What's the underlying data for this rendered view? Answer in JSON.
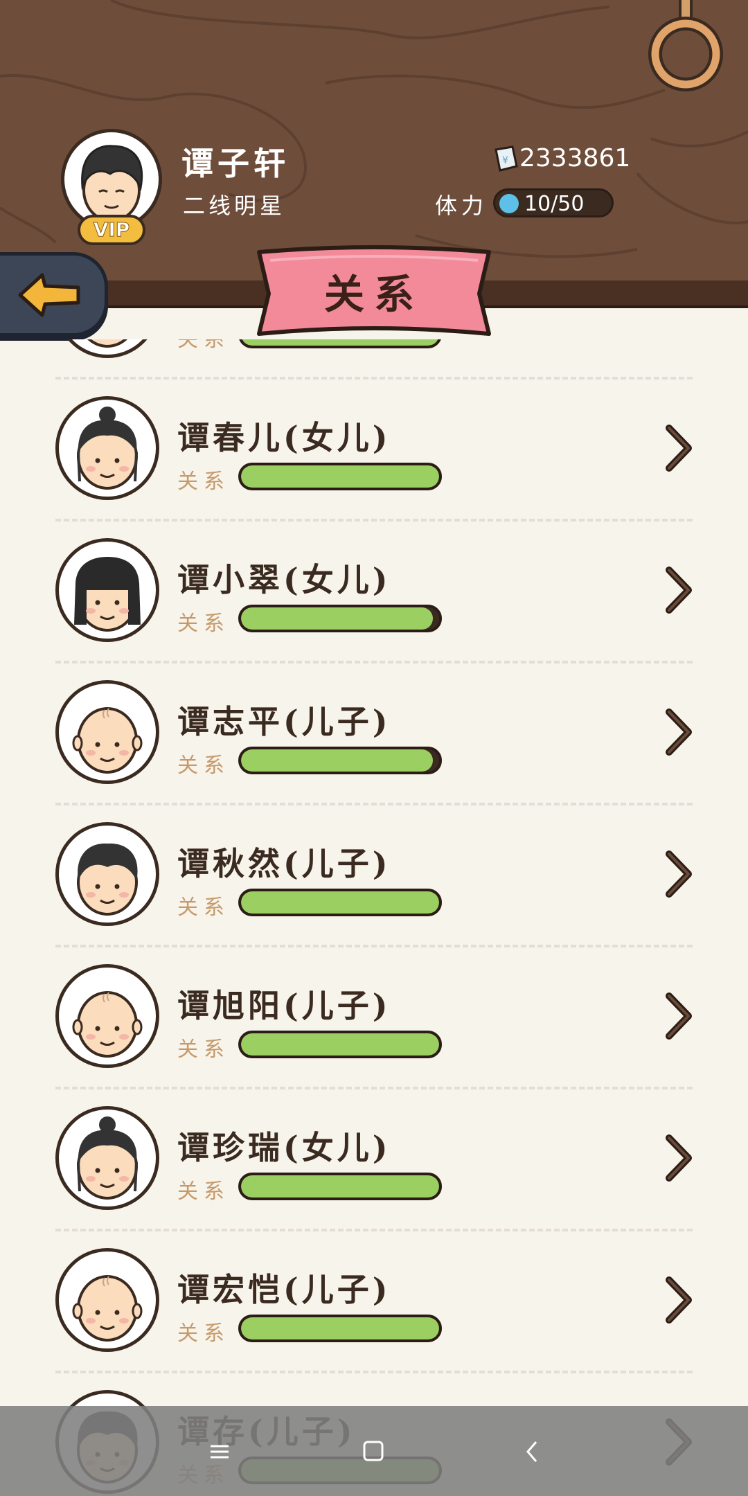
{
  "player": {
    "name": "谭子轩",
    "title": "二线明星",
    "vip": "VIP",
    "money": "2333861",
    "stamina_label": "体力",
    "stamina": "10/50"
  },
  "page": {
    "title": "关系"
  },
  "relation_label": "关系",
  "members": [
    {
      "name": "",
      "relation_level": 1.0,
      "hair": "bald"
    },
    {
      "name": "谭春儿(女儿)",
      "relation_level": 1.0,
      "hair": "bun"
    },
    {
      "name": "谭小翠(女儿)",
      "relation_level": 0.97,
      "hair": "bob"
    },
    {
      "name": "谭志平(儿子)",
      "relation_level": 0.97,
      "hair": "bald"
    },
    {
      "name": "谭秋然(儿子)",
      "relation_level": 1.0,
      "hair": "short"
    },
    {
      "name": "谭旭阳(儿子)",
      "relation_level": 1.0,
      "hair": "bald"
    },
    {
      "name": "谭珍瑞(女儿)",
      "relation_level": 1.0,
      "hair": "bun"
    },
    {
      "name": "谭宏恺(儿子)",
      "relation_level": 1.0,
      "hair": "bald"
    },
    {
      "name": "谭存(儿子)",
      "relation_level": 1.0,
      "hair": "short"
    }
  ],
  "icons": {
    "back": "back-arrow-icon",
    "money": "banknote-icon",
    "stamina": "stamina-orb-icon",
    "chevron": "chevron-right-icon",
    "nav_menu": "menu-icon",
    "nav_home": "home-square-icon",
    "nav_back": "nav-back-icon"
  },
  "colors": {
    "wood": "#6e4d3b",
    "ribbon": "#f28a9a",
    "bar_fill": "#9bcf62",
    "background": "#f7f4ec"
  }
}
